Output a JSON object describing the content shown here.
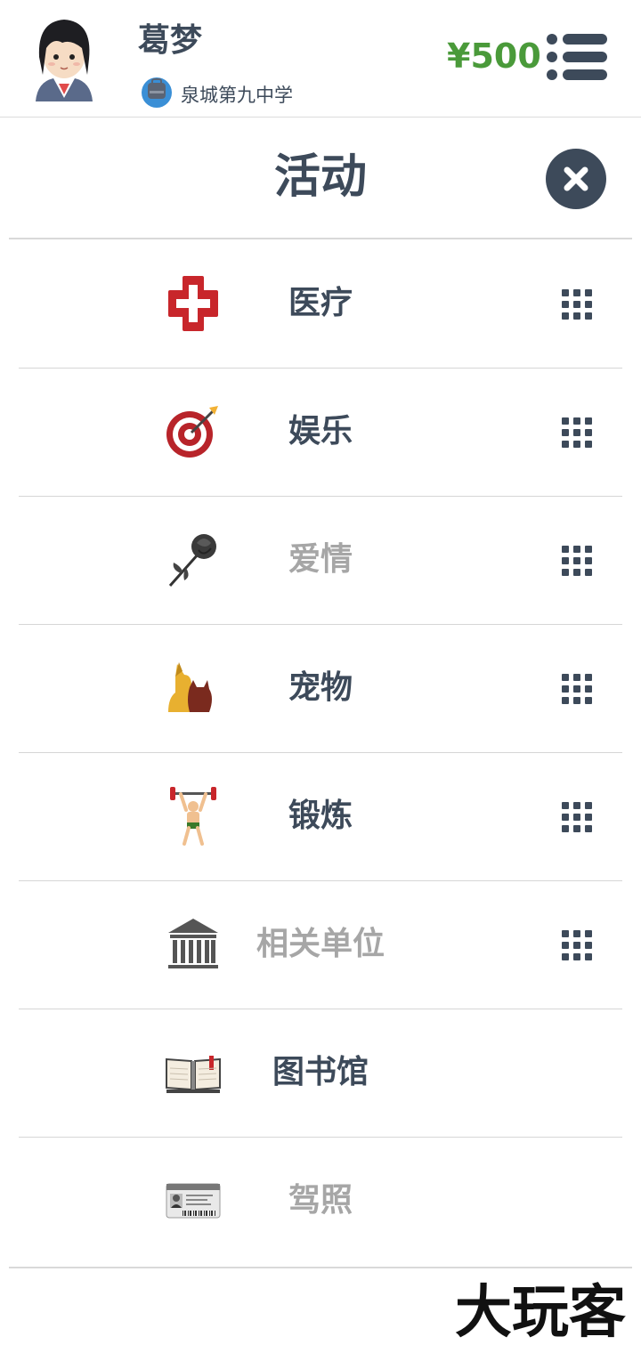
{
  "header": {
    "user_name": "葛梦",
    "school": "泉城第九中学",
    "money": "¥500"
  },
  "panel": {
    "title": "活动"
  },
  "items": [
    {
      "label": "医疗",
      "icon": "medical-cross-icon",
      "enabled": true
    },
    {
      "label": "娱乐",
      "icon": "target-dart-icon",
      "enabled": true
    },
    {
      "label": "爱情",
      "icon": "rose-icon",
      "enabled": false
    },
    {
      "label": "宠物",
      "icon": "dog-cat-icon",
      "enabled": true
    },
    {
      "label": "锻炼",
      "icon": "weightlifter-icon",
      "enabled": true
    },
    {
      "label": "相关单位",
      "icon": "government-building-icon",
      "enabled": false
    },
    {
      "label": "图书馆",
      "icon": "open-book-icon",
      "enabled": true
    },
    {
      "label": "驾照",
      "icon": "driver-license-icon",
      "enabled": false
    }
  ],
  "watermark": {
    "text": "大玩客"
  },
  "colors": {
    "text_dark": "#3d4a5a",
    "text_disabled": "#a6a6a6",
    "money_green": "#4a9a3a",
    "divider": "#d6d6d6"
  }
}
